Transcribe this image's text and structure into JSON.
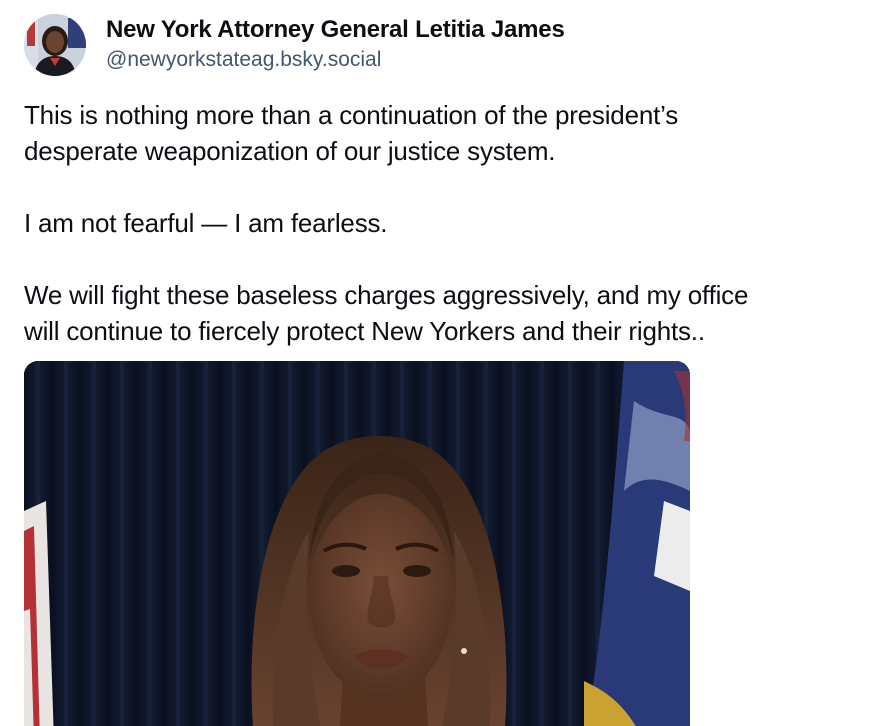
{
  "post": {
    "author": {
      "display_name": "New York Attorney General Letitia James",
      "handle": "@newyorkstateag.bsky.social"
    },
    "text": {
      "para1_line1": "This is nothing more than a continuation of the president’s",
      "para1_line2": "desperate weaponization of our justice system.",
      "para2_line1": "I am not fearful — I am fearless.",
      "para3_line1": "We will fight these baseless charges aggressively, and my office",
      "para3_line2": "will continue to fiercely protect New Yorkers and their rights.."
    },
    "colors": {
      "handle": "#42576c",
      "text": "#0b0f14",
      "curtain": "#0d1424",
      "flag_blue": "#2a3a78",
      "flag_gold": "#c9a230"
    }
  }
}
